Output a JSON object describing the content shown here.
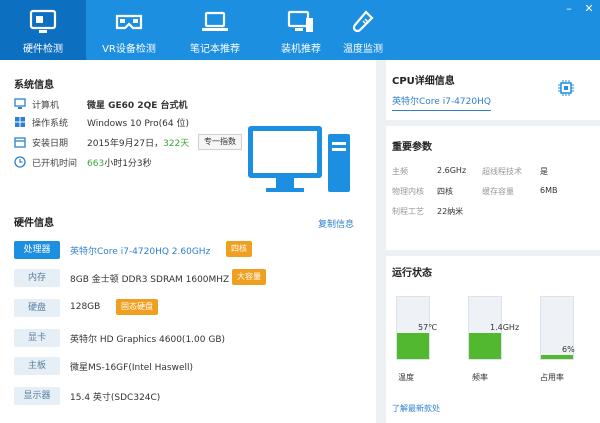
{
  "tabs": [
    {
      "label": "硬件检测",
      "icon": "monitor-icon",
      "active": true
    },
    {
      "label": "VR设备检测",
      "icon": "vr-headset-icon",
      "active": false
    },
    {
      "label": "笔记本推荐",
      "icon": "laptop-icon",
      "active": false
    },
    {
      "label": "装机推荐",
      "icon": "pc-build-icon",
      "active": false
    },
    {
      "label": "温度监测",
      "icon": "thermometer-icon",
      "active": false
    }
  ],
  "window": {
    "minimize": "–",
    "close": "✕"
  },
  "system": {
    "title": "系统信息",
    "computer_label": "计算机",
    "computer_value": "微星 GE60 2QE 台式机",
    "os_label": "操作系统",
    "os_value": "Windows 10 Pro(64 位)",
    "install_label": "安装日期",
    "install_value": "2015年9月27日，",
    "install_days": "322天",
    "score_button": "专一指数",
    "uptime_label": "已开机时间",
    "uptime_value_prefix": "663",
    "uptime_value_suffix": "小时1分3秒"
  },
  "hardware": {
    "title": "硬件信息",
    "copy_link": "复制信息",
    "rows": [
      {
        "tag": "处理器",
        "value": "英特尔Core i7-4720HQ 2.60GHz",
        "badge": "四核"
      },
      {
        "tag": "内存",
        "value": "8GB 金士顿 DDR3 SDRAM 1600MHZ",
        "badge": "大容量"
      },
      {
        "tag": "硬盘",
        "value": "128GB",
        "badge": "固态硬盘"
      },
      {
        "tag": "显卡",
        "value": "英特尔 HD Graphics 4600(1.00 GB)",
        "badge": ""
      },
      {
        "tag": "主板",
        "value": "微星MS-16GF(Intel Haswell)",
        "badge": ""
      },
      {
        "tag": "显示器",
        "value": "15.4 英寸(SDC324C)",
        "badge": ""
      }
    ]
  },
  "cpu": {
    "title": "CPU详细信息",
    "name": "英特尔Core i7-4720HQ",
    "params_title": "重要参数",
    "params": {
      "freq_label": "主频",
      "freq_value": "2.6GHz",
      "ht_label": "超线程技术",
      "ht_value": "是",
      "cores_label": "物理内核",
      "cores_value": "四核",
      "cache_label": "缓存容量",
      "cache_value": "6MB",
      "process_label": "制程工艺",
      "process_value": "22纳米"
    }
  },
  "status": {
    "title": "运行状态",
    "gauges": [
      {
        "label": "温度",
        "value": "57℃",
        "level": 0.42
      },
      {
        "label": "频率",
        "value": "1.4GHz",
        "level": 0.42
      },
      {
        "label": "占用率",
        "value": "6%",
        "level": 0.06
      }
    ],
    "update_link": "了解最新款处"
  },
  "colors": {
    "accent": "#1c8fe0",
    "active_tab": "#0d6fc0",
    "badge": "#f0a020",
    "gauge": "#52b830"
  }
}
